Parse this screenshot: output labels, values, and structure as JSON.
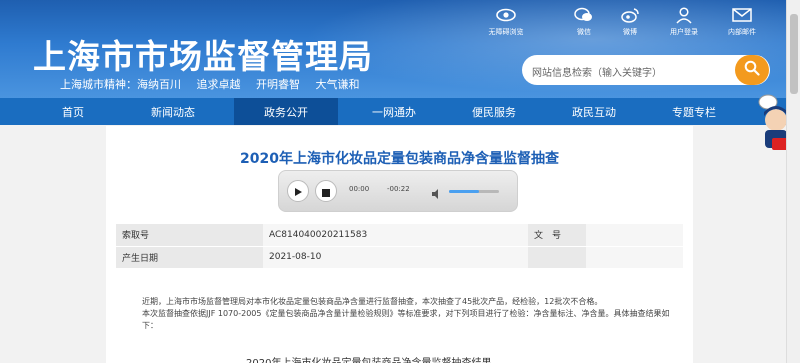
{
  "header": {
    "site_title": "上海市市场监督管理局",
    "motto": [
      "上海城市精神：海纳百川",
      "追求卓越",
      "开明睿智",
      "大气谦和"
    ],
    "toolbar": [
      {
        "label": "无障碍浏览",
        "icon": "eye-icon"
      },
      {
        "label": "微信",
        "icon": "wechat-icon"
      },
      {
        "label": "微博",
        "icon": "weibo-icon"
      },
      {
        "label": "用户登录",
        "icon": "user-login-icon"
      },
      {
        "label": "内部邮件",
        "icon": "mail-icon"
      }
    ],
    "search": {
      "placeholder": "网站信息检索（输入关键字）",
      "button_icon": "search-icon"
    }
  },
  "nav": {
    "items": [
      {
        "label": "首页"
      },
      {
        "label": "新闻动态"
      },
      {
        "label": "政务公开",
        "active": true
      },
      {
        "label": "一网通办"
      },
      {
        "label": "便民服务"
      },
      {
        "label": "政民互动"
      },
      {
        "label": "专题专栏"
      }
    ]
  },
  "article": {
    "title": "2020年上海市化妆品定量包装商品净含量监督抽查",
    "player": {
      "current_time": "00:00",
      "duration": "-00:22",
      "volume_fraction": 0.6
    },
    "meta": [
      {
        "key": "索取号",
        "value": "AC814040020211583",
        "key2": "文　号",
        "value2": ""
      },
      {
        "key": "产生日期",
        "value": "2021-08-10",
        "key2": "",
        "value2": ""
      }
    ],
    "paragraphs": [
      "近期，上海市市场监督管理局对本市化妆品定量包装商品净含量进行监督抽查，本次抽查了45批次产品，经检验，12批次不合格。",
      "本次监督抽查依据JJF 1070-2005《定量包装商品净含量计量检验规则》等标准要求，对下列项目进行了检验：净含量标注、净含量。具体抽查结果如下："
    ],
    "subhead": "2020年上海市化妆品定量包装商品净含量监督抽查结果"
  },
  "colors": {
    "brand_blue": "#1a6dc0",
    "title_blue": "#1d5fb5",
    "search_orange": "#f39a1e"
  }
}
